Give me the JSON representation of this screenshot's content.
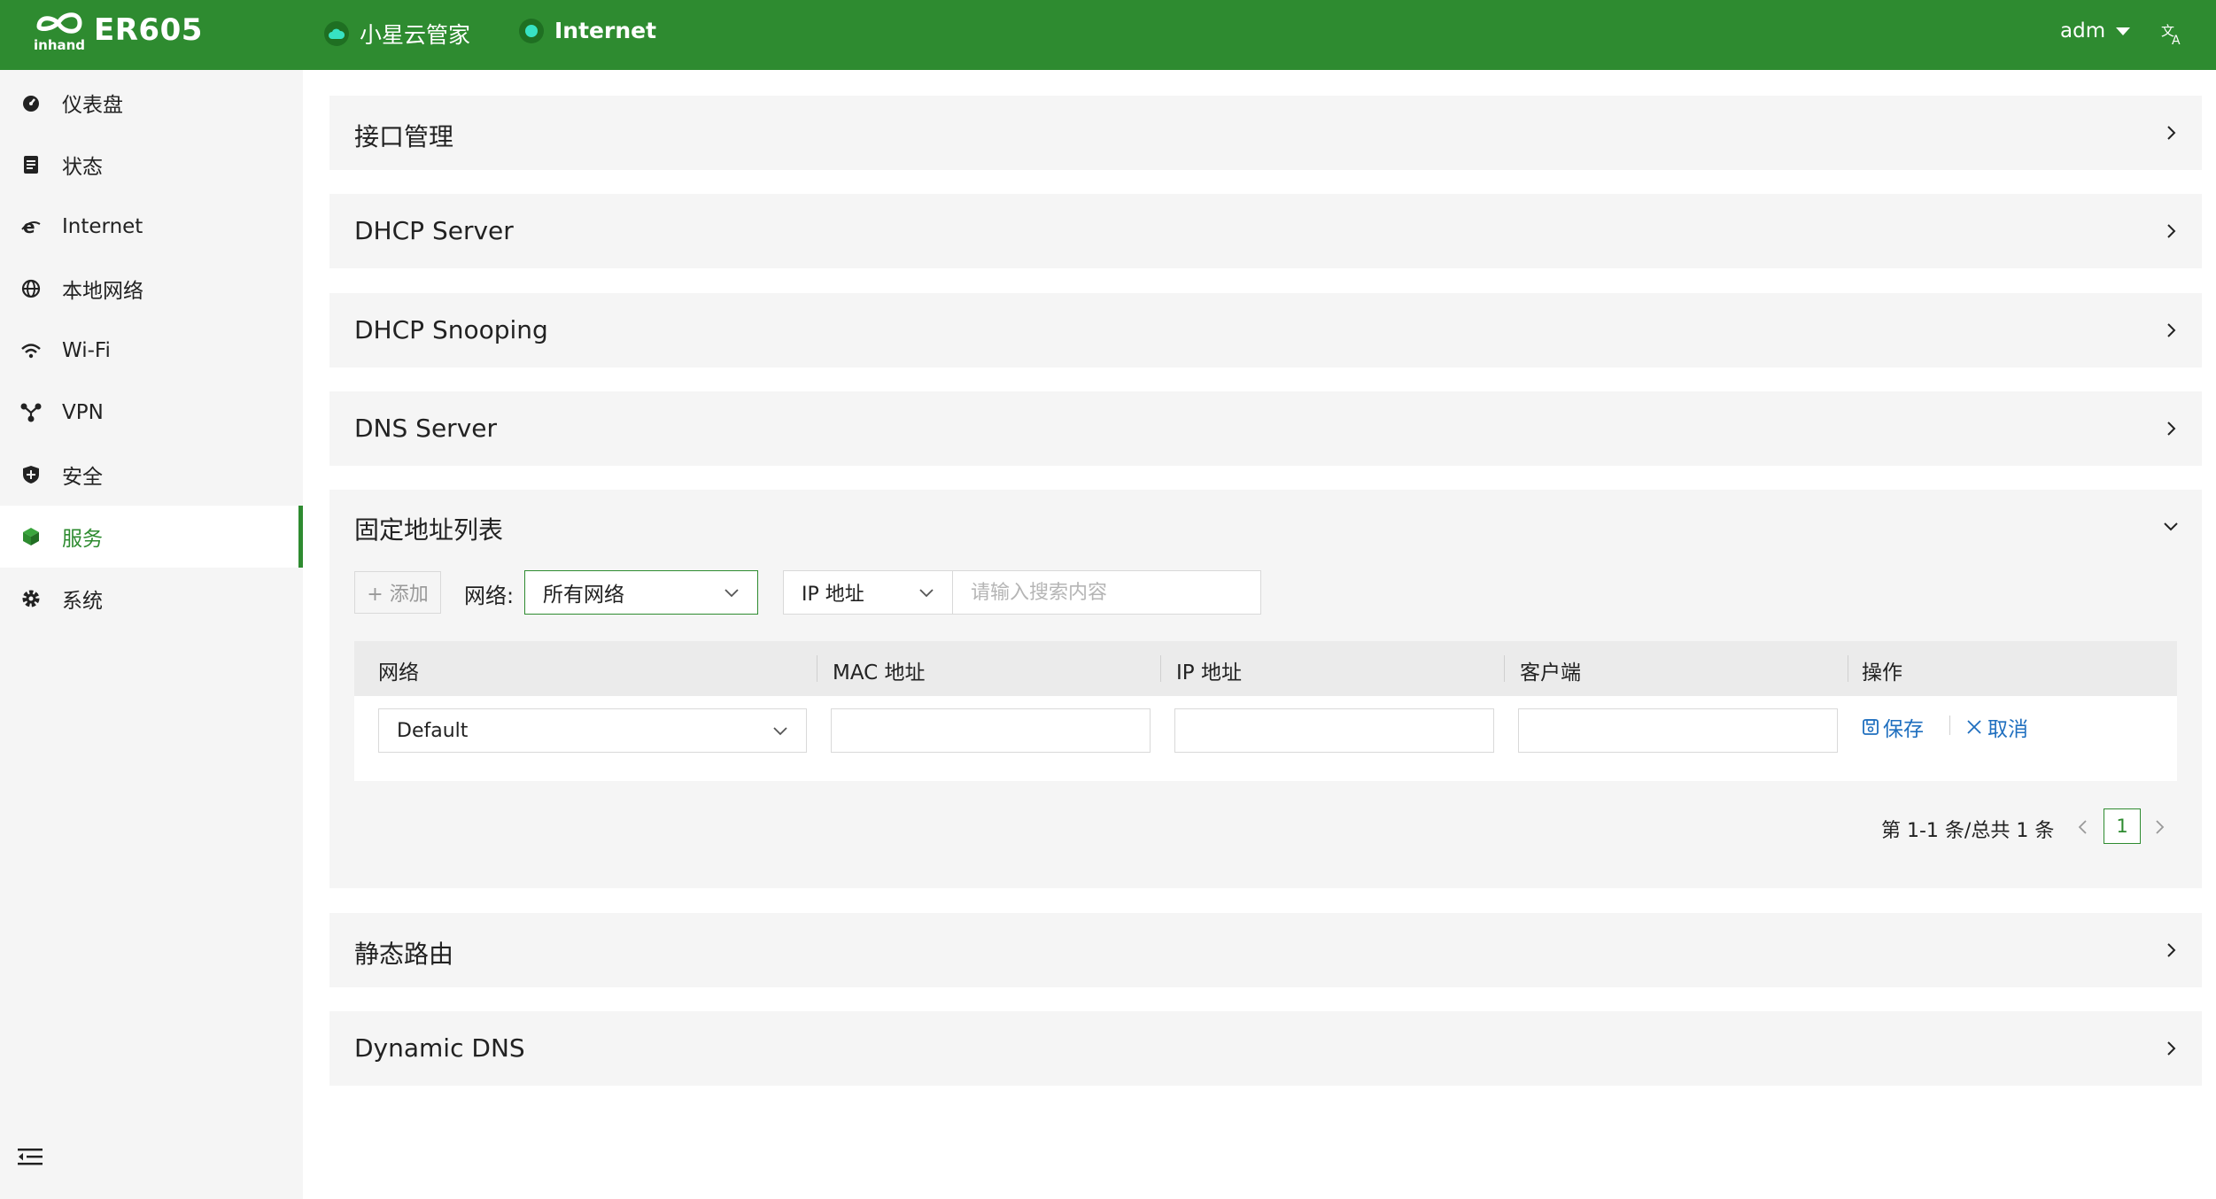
{
  "header": {
    "product": "ER605",
    "logo_text": "inhand",
    "cloud_label": "小星云管家",
    "internet_label": "Internet",
    "user": "adm",
    "lang_icon": "translate-icon",
    "brand_color": "#2e8b30",
    "status_dot_color": "#37e3c3"
  },
  "sidebar": {
    "items": [
      {
        "label": "仪表盘",
        "icon": "dashboard-icon"
      },
      {
        "label": "状态",
        "icon": "status-icon"
      },
      {
        "label": "Internet",
        "icon": "internet-icon"
      },
      {
        "label": "本地网络",
        "icon": "globe-icon"
      },
      {
        "label": "Wi-Fi",
        "icon": "wifi-icon"
      },
      {
        "label": "VPN",
        "icon": "vpn-icon"
      },
      {
        "label": "安全",
        "icon": "shield-icon"
      },
      {
        "label": "服务",
        "icon": "cube-icon",
        "active": true
      },
      {
        "label": "系统",
        "icon": "gear-icon"
      }
    ],
    "collapse_icon": "collapse-menu-icon"
  },
  "panels": {
    "p1": "接口管理",
    "p2": "DHCP Server",
    "p3": "DHCP Snooping",
    "p4": "DNS Server",
    "p5": "固定地址列表",
    "p6": "静态路由",
    "p7": "Dynamic DNS"
  },
  "toolbar": {
    "add_label": "+ 添加",
    "network_label": "网络:",
    "network_value": "所有网络",
    "search_field": "IP 地址",
    "search_placeholder": "请输入搜索内容"
  },
  "table": {
    "columns": [
      "网络",
      "MAC 地址",
      "IP 地址",
      "客户端",
      "操作"
    ],
    "row": {
      "network": "Default",
      "mac": "",
      "ip": "",
      "client": "",
      "save": "保存",
      "cancel": "取消"
    }
  },
  "pagination": {
    "summary": "第 1-1 条/总共 1 条",
    "current_page": "1"
  }
}
